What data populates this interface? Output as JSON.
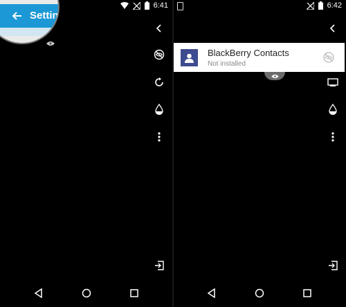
{
  "left": {
    "status": {
      "time": "6:41"
    },
    "magnifier": {
      "title": "Settin"
    }
  },
  "right": {
    "status": {
      "time": "6:42"
    },
    "notification": {
      "title": "BlackBerry Contacts",
      "subtitle": "Not installed"
    }
  },
  "icons": {
    "left_sidebar": [
      "chevron-left-icon",
      "eye-off-icon",
      "rotate-icon",
      "drop-icon",
      "more-vert-icon",
      "exit-icon"
    ],
    "right_sidebar": [
      "chevron-left-icon",
      "cast-icon",
      "drop-icon",
      "more-vert-icon",
      "exit-icon"
    ],
    "nav": [
      "back-icon",
      "home-icon",
      "recents-icon"
    ]
  },
  "colors": {
    "accent": "#1b98d5",
    "contact_icon_bg": "#3d4b90",
    "background": "#000000"
  }
}
